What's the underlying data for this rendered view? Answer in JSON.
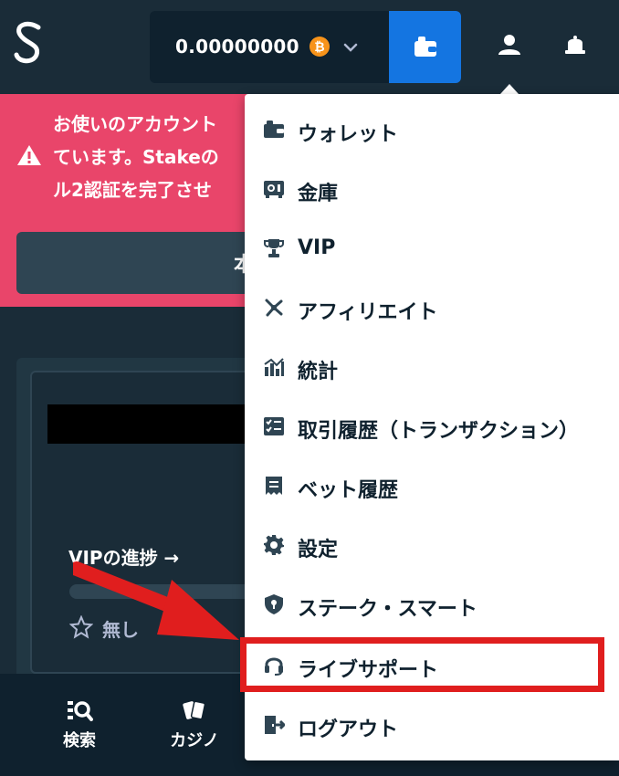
{
  "header": {
    "logo_icon": "stake-logo-icon",
    "balance": "0.00000000",
    "currency_icon": "bitcoin-icon",
    "colors": {
      "background": "#1a2c38",
      "wallet_button": "#1475e1",
      "balance_box": "#0f212e"
    }
  },
  "banner": {
    "text": "お使いのアカウント\nています。Stakeの\nル2認証を完了させ",
    "button_label": "本",
    "color": "#e9456a"
  },
  "profile": {
    "vip_progress_label": "VIPの進捗 →",
    "rank_label": "無し",
    "vip_progress": 0
  },
  "bottom_nav": [
    {
      "label": "検索",
      "icon": "search-icon"
    },
    {
      "label": "カジノ",
      "icon": "cards-icon"
    }
  ],
  "menu": [
    {
      "label": "ウォレット",
      "icon": "wallet-icon"
    },
    {
      "label": "金庫",
      "icon": "vault-icon"
    },
    {
      "label": "VIP",
      "icon": "trophy-icon"
    },
    {
      "label": "アフィリエイト",
      "icon": "affiliate-icon"
    },
    {
      "label": "統計",
      "icon": "stats-icon"
    },
    {
      "label": "取引履歴（トランザクション）",
      "icon": "transactions-icon"
    },
    {
      "label": "ベット履歴",
      "icon": "receipt-icon"
    },
    {
      "label": "設定",
      "icon": "gear-icon"
    },
    {
      "label": "ステーク・スマート",
      "icon": "shield-icon"
    },
    {
      "label": "ライブサポート",
      "icon": "headset-icon",
      "highlighted": true
    },
    {
      "label": "ログアウト",
      "icon": "logout-icon"
    }
  ],
  "annotation": {
    "color": "#e01e1e"
  }
}
